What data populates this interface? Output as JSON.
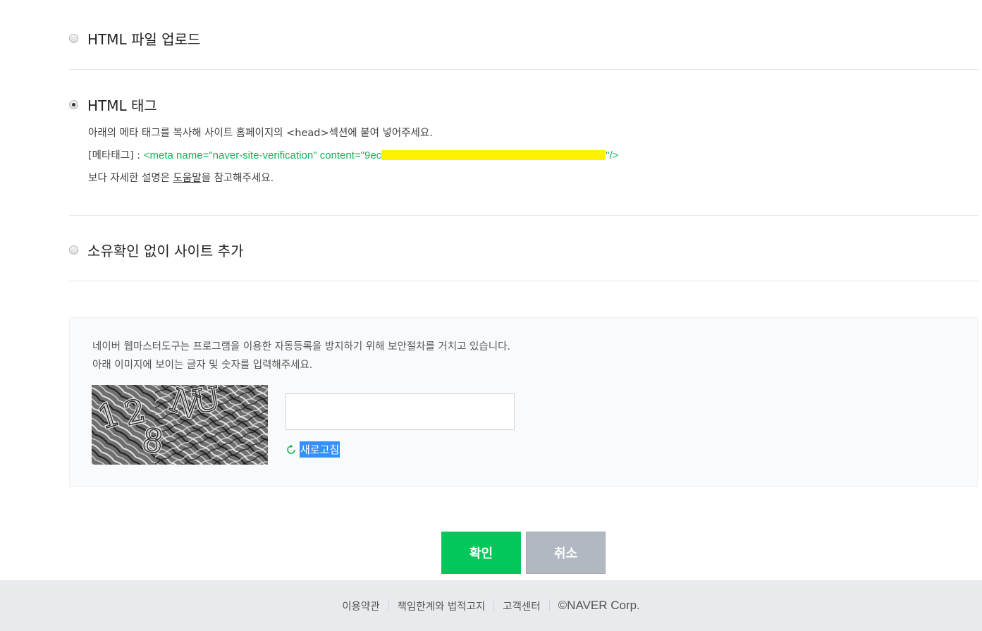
{
  "options": {
    "file_upload": {
      "label": "HTML 파일 업로드",
      "checked": false
    },
    "html_tag": {
      "label": "HTML 태그",
      "checked": true
    },
    "no_verify": {
      "label": "소유확인 없이 사이트 추가",
      "checked": false
    }
  },
  "html_tag_desc": {
    "instruction": "아래의 메타 태그를 복사해 사이트 홈페이지의 <head>섹션에 붙여 넣어주세요.",
    "meta_label": "[메타태그] : ",
    "meta_code_prefix": "<meta name=\"naver-site-verification\" content=\"9ec",
    "meta_code_suffix": "\"/>",
    "help_prefix": "보다 자세한 설명은 ",
    "help_link": "도움말",
    "help_suffix": "을 참고해주세요."
  },
  "captcha": {
    "line1": "네이버 웹마스터도구는 프로그램을 이용한 자동등록을 방지하기 위해 보안절차를 거치고 있습니다.",
    "line2": "아래 이미지에 보이는 글자 및 숫자를 입력해주세요.",
    "image_chars": [
      "1",
      "2",
      "8",
      "N",
      "U"
    ],
    "input_value": "",
    "input_placeholder": "",
    "refresh_label": "새로고침"
  },
  "buttons": {
    "confirm": "확인",
    "cancel": "취소"
  },
  "footer": {
    "links": [
      "이용약관",
      "책임한계와 법적고지",
      "고객센터"
    ],
    "copyright": "©NAVER Corp."
  },
  "colors": {
    "primary": "#03c75a",
    "secondary": "#b1b8c1",
    "meta_code": "#11b35a",
    "redaction": "#fff200",
    "selection": "#3390ff"
  }
}
